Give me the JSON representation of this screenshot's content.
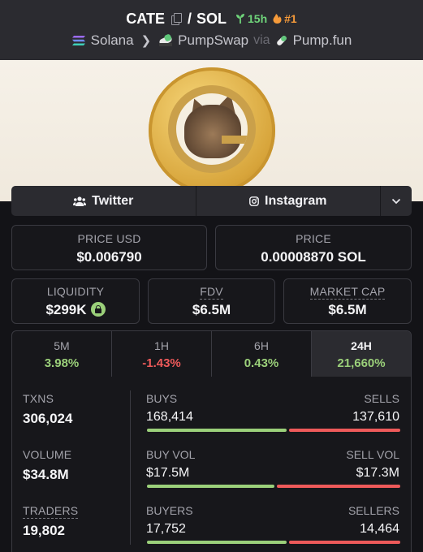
{
  "header": {
    "base_token": "CATE",
    "separator": "/",
    "quote_token": "SOL",
    "age": "15h",
    "rank": "#1",
    "chain": "Solana",
    "dex": "PumpSwap",
    "via": "via",
    "launchpad": "Pump.fun"
  },
  "social": {
    "twitter": "Twitter",
    "instagram": "Instagram"
  },
  "price": {
    "usd_label": "PRICE USD",
    "usd_value": "$0.006790",
    "native_label": "PRICE",
    "native_value": "0.00008870 SOL"
  },
  "metrics": {
    "liquidity_label": "LIQUIDITY",
    "liquidity_value": "$299K",
    "fdv_label": "FDV",
    "fdv_value": "$6.5M",
    "mcap_label": "MARKET CAP",
    "mcap_value": "$6.5M"
  },
  "periods": [
    {
      "label": "5M",
      "value": "3.98%",
      "trend": "up"
    },
    {
      "label": "1H",
      "value": "-1.43%",
      "trend": "down"
    },
    {
      "label": "6H",
      "value": "0.43%",
      "trend": "up"
    },
    {
      "label": "24H",
      "value": "21,660%",
      "trend": "up",
      "active": true
    }
  ],
  "stats": {
    "txns_label": "TXNS",
    "txns_value": "306,024",
    "volume_label": "VOLUME",
    "volume_value": "$34.8M",
    "traders_label": "TRADERS",
    "traders_value": "19,802",
    "buys_label": "BUYS",
    "buys_value": "168,414",
    "sells_label": "SELLS",
    "sells_value": "137,610",
    "buy_vol_label": "BUY VOL",
    "buy_vol_value": "$17.5M",
    "sell_vol_label": "SELL VOL",
    "sell_vol_value": "$17.3M",
    "buyers_label": "BUYERS",
    "buyers_value": "17,752",
    "sellers_label": "SELLERS",
    "sellers_value": "14,464"
  },
  "colors": {
    "positive": "#9bd07a",
    "negative": "#ee5a5a",
    "age_badge": "#6fd47a",
    "rank_badge": "#f59a3a"
  },
  "icons": [
    "copy-icon",
    "seedling-icon",
    "flame-icon",
    "solana-icon",
    "chevron-right-icon",
    "pumpswap-icon",
    "pill-icon",
    "users-icon",
    "instagram-icon",
    "chevron-down-icon",
    "lock-icon"
  ]
}
